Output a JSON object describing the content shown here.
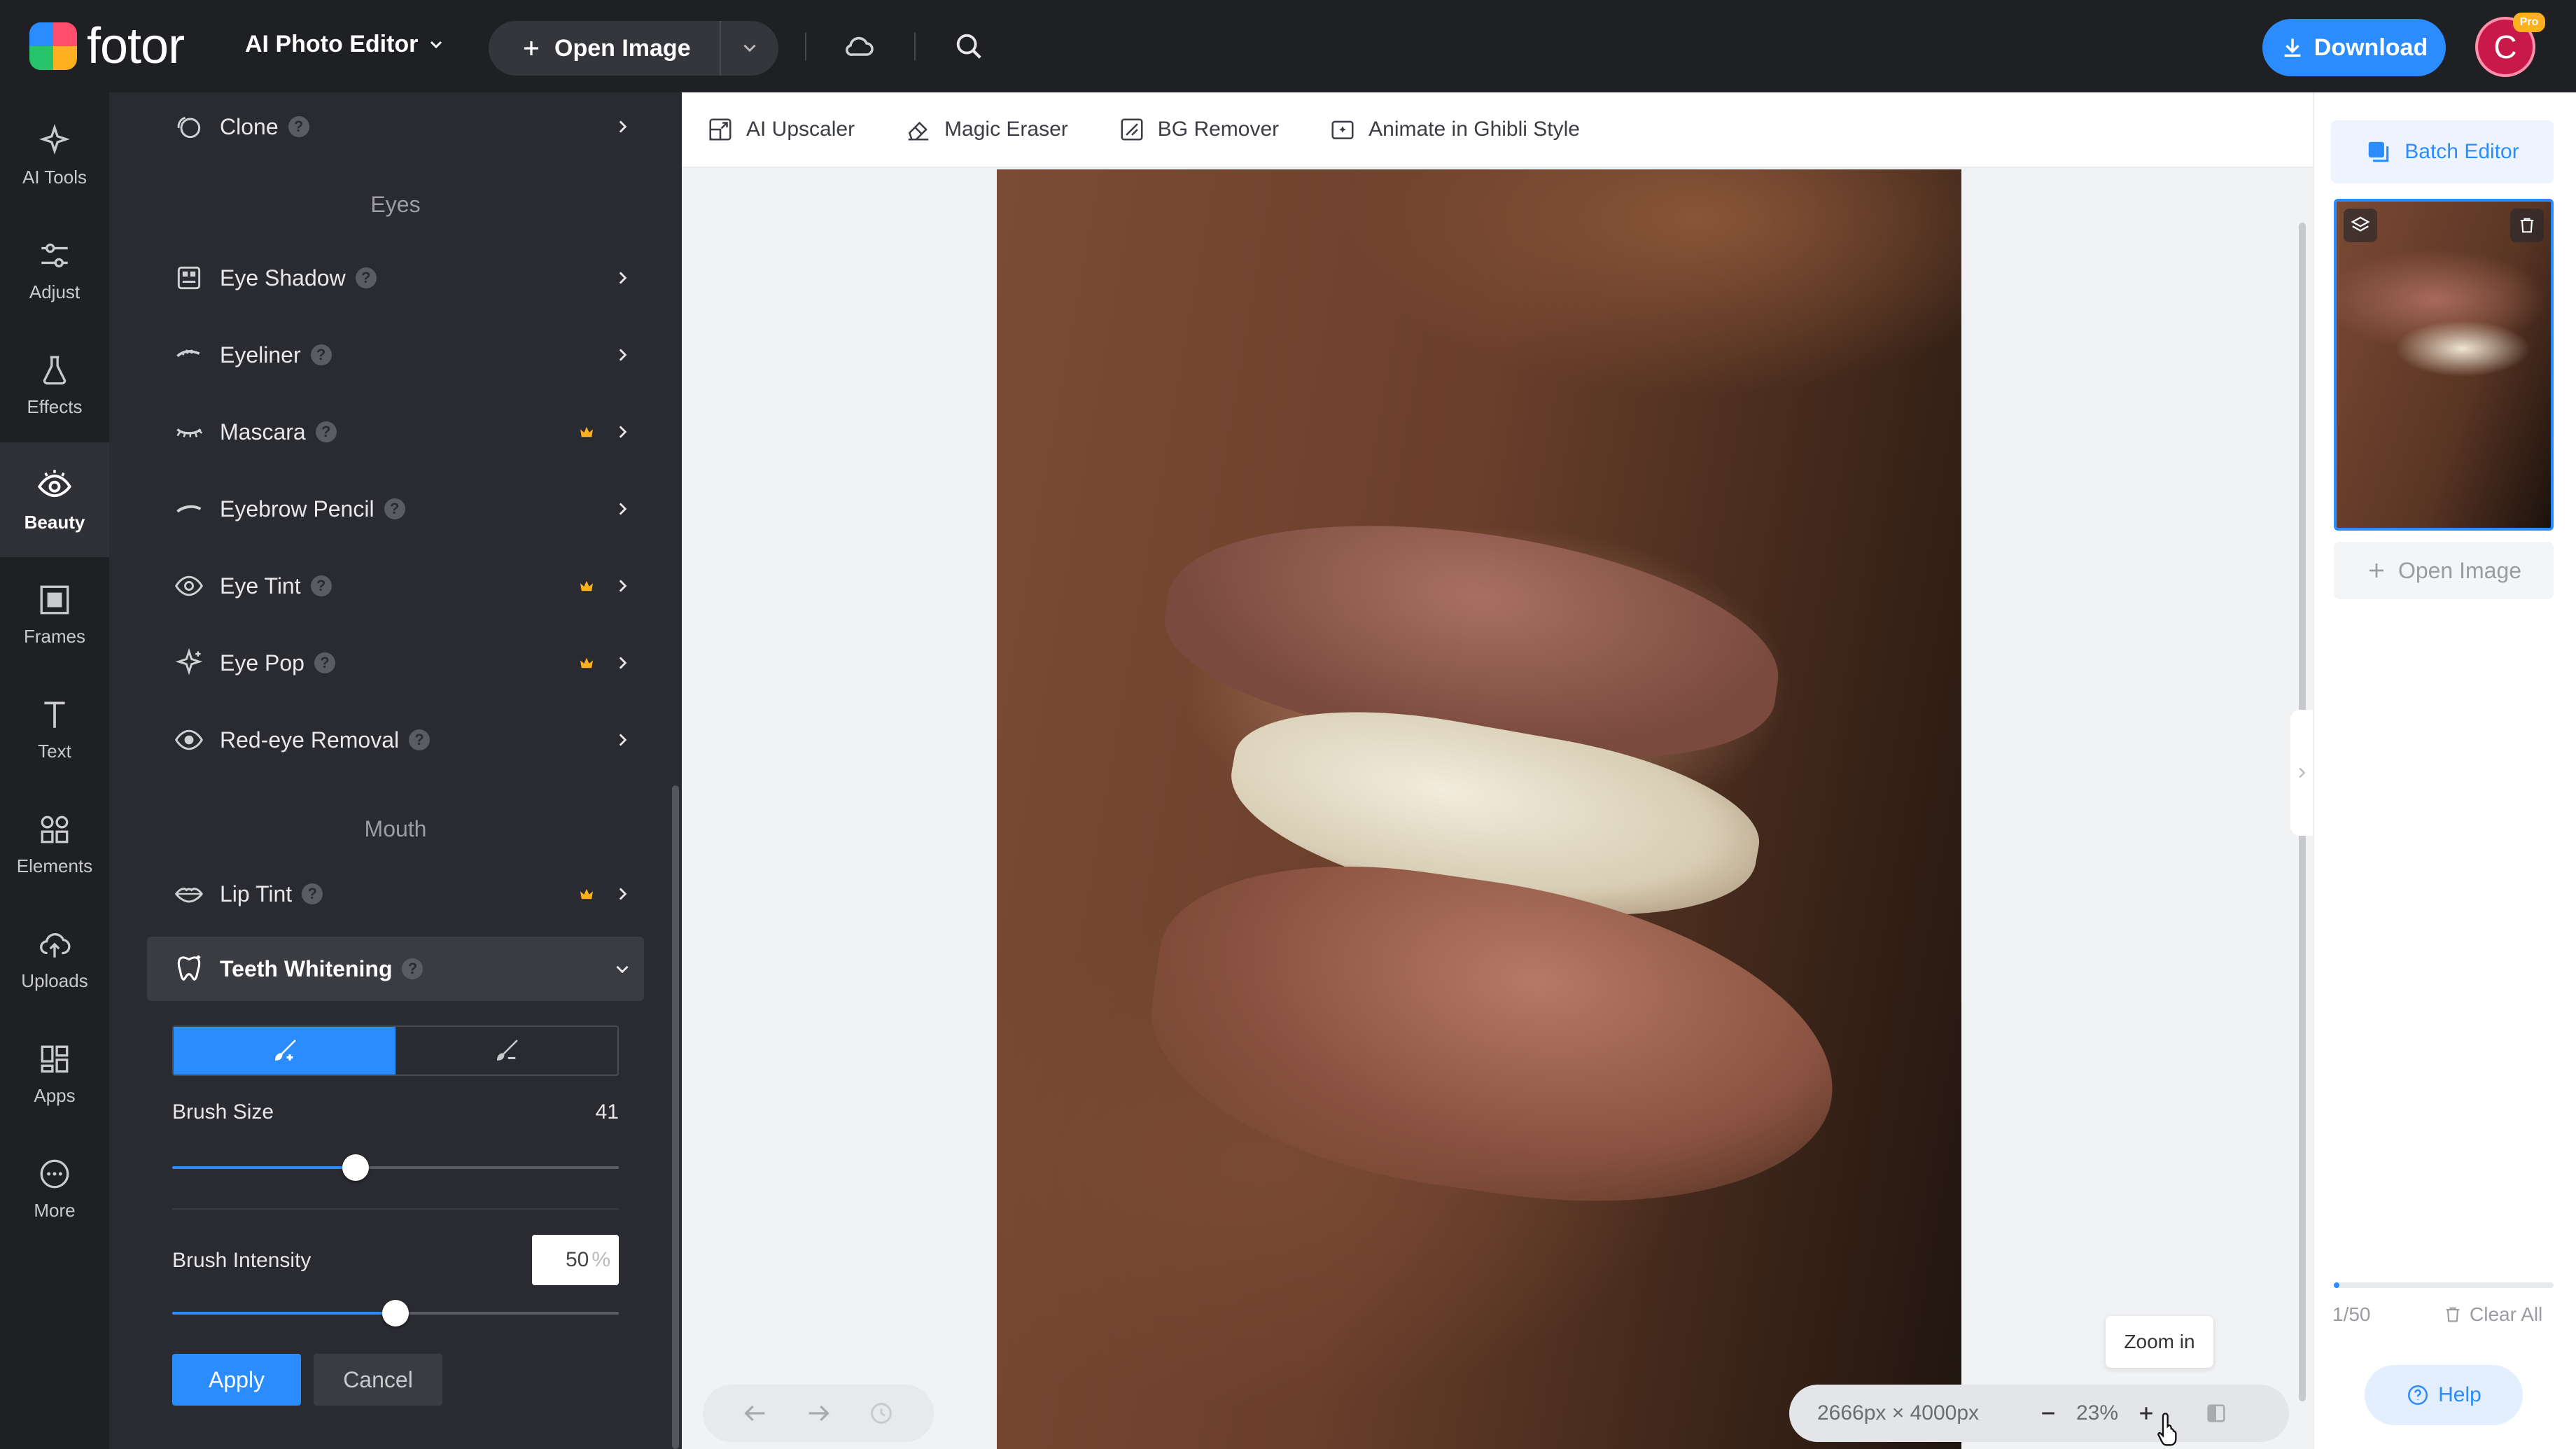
{
  "header": {
    "logo_text": "fotor",
    "mode": "AI Photo Editor",
    "open_image": "Open Image",
    "download": "Download",
    "avatar_initial": "C",
    "pro_badge": "Pro"
  },
  "rail": {
    "items": [
      {
        "label": "AI Tools",
        "icon": "sparkle-icon"
      },
      {
        "label": "Adjust",
        "icon": "sliders-icon"
      },
      {
        "label": "Effects",
        "icon": "flask-icon"
      },
      {
        "label": "Beauty",
        "icon": "eye-icon",
        "active": true
      },
      {
        "label": "Frames",
        "icon": "frame-icon"
      },
      {
        "label": "Text",
        "icon": "text-icon"
      },
      {
        "label": "Elements",
        "icon": "shapes-icon"
      },
      {
        "label": "Uploads",
        "icon": "cloud-upload-icon"
      },
      {
        "label": "Apps",
        "icon": "apps-icon"
      },
      {
        "label": "More",
        "icon": "more-icon"
      }
    ]
  },
  "beauty": {
    "clone": "Clone",
    "section_eyes": "Eyes",
    "eyes": [
      {
        "label": "Eye Shadow",
        "premium": false
      },
      {
        "label": "Eyeliner",
        "premium": false
      },
      {
        "label": "Mascara",
        "premium": true
      },
      {
        "label": "Eyebrow Pencil",
        "premium": false
      },
      {
        "label": "Eye Tint",
        "premium": true
      },
      {
        "label": "Eye Pop",
        "premium": true
      },
      {
        "label": "Red-eye Removal",
        "premium": false
      }
    ],
    "section_mouth": "Mouth",
    "lip_tint": "Lip Tint",
    "teeth_whitening": "Teeth Whitening",
    "brush_size_label": "Brush Size",
    "brush_size_value": "41",
    "brush_size_level": 0.41,
    "brush_intensity_label": "Brush Intensity",
    "brush_intensity_value": "50",
    "brush_intensity_unit": "%",
    "brush_intensity_level": 0.5,
    "apply": "Apply",
    "cancel": "Cancel",
    "help_mark": "?"
  },
  "toolbar": {
    "ai_upscaler": "AI Upscaler",
    "magic_eraser": "Magic Eraser",
    "bg_remover": "BG Remover",
    "ghibli": "Animate in Ghibli Style"
  },
  "canvas": {
    "dimensions": "2666px × 4000px",
    "zoom": "23%",
    "tooltip": "Zoom in"
  },
  "right": {
    "batch_editor": "Batch Editor",
    "open_image": "Open Image",
    "page_count": "1/50",
    "clear_all": "Clear All",
    "help": "Help"
  },
  "colors": {
    "accent": "#2b8cff",
    "premium": "#ffb020",
    "panel_bg": "#2a2b30",
    "header_bg": "#1f2024"
  }
}
